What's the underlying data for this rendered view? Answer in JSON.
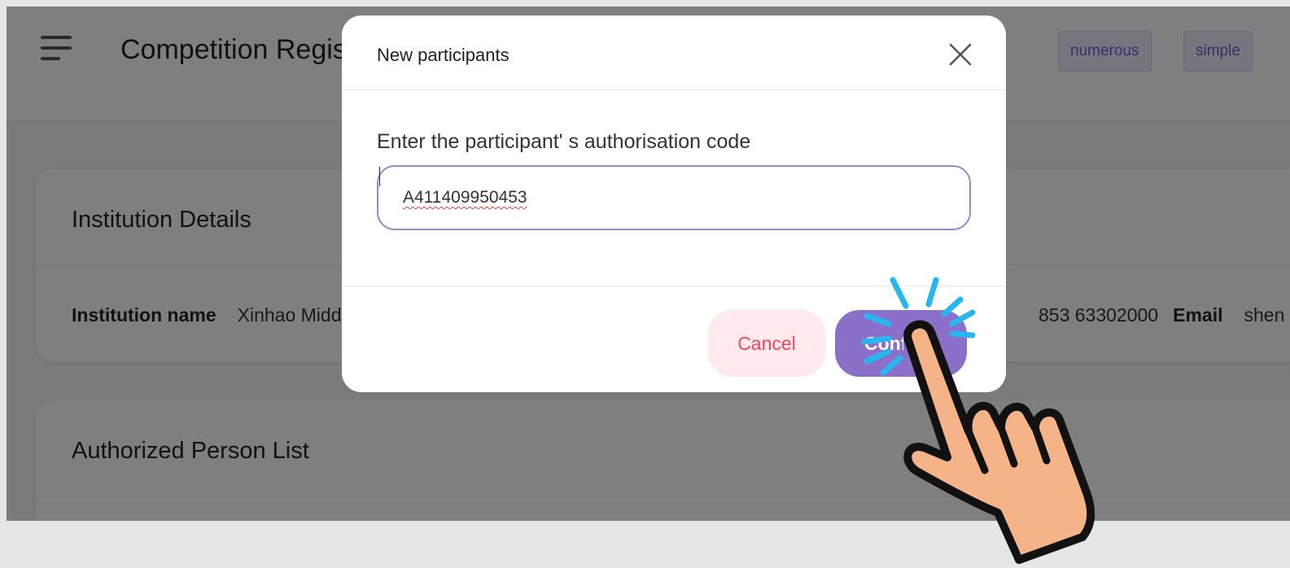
{
  "header": {
    "title": "Competition Registration",
    "tags": [
      "numerous",
      "simple"
    ]
  },
  "institution_card": {
    "title": "Institution Details",
    "name_label": "Institution name",
    "name_value": "Xinhao Middle School",
    "phone_value": "853 63302000",
    "email_label": "Email",
    "email_value": "shen"
  },
  "authorized_card": {
    "title": "Authorized Person List"
  },
  "dialog": {
    "title": "New participants",
    "field_label": "Enter the participant' s authorisation code",
    "field_value": "A411409950453",
    "cancel_label": "Cancel",
    "confirm_label": "Confirm"
  },
  "colors": {
    "accent": "#8a70c9",
    "cancel_text": "#e8475d",
    "cancel_bg": "#ffe9ea",
    "sparkle": "#27b7f0",
    "hand_skin": "#f5b388"
  },
  "icons": [
    "menu-icon",
    "close-icon",
    "pointing-hand-icon"
  ]
}
